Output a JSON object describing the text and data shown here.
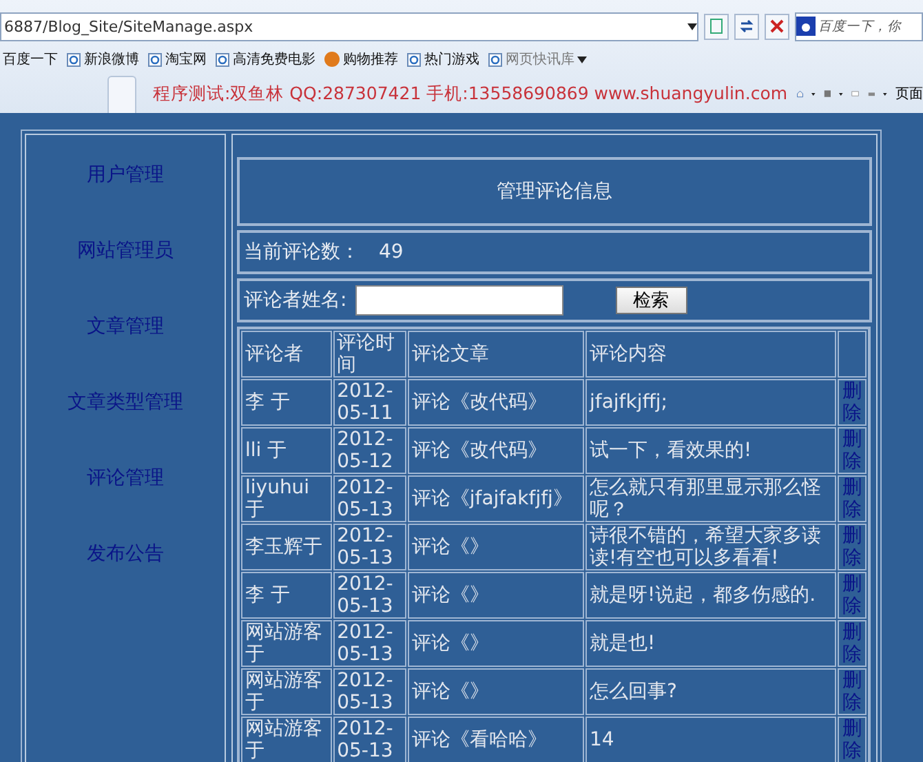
{
  "address_bar": {
    "url": "6887/Blog_Site/SiteManage.aspx",
    "search_placeholder": "百度一下，你"
  },
  "favorites": [
    {
      "label": "百度一下",
      "kind": "plain"
    },
    {
      "label": "新浪微博",
      "kind": "ie"
    },
    {
      "label": "淘宝网",
      "kind": "ie"
    },
    {
      "label": "高清免费电影",
      "kind": "ie"
    },
    {
      "label": "购物推荐",
      "kind": "shop"
    },
    {
      "label": "热门游戏",
      "kind": "ie"
    },
    {
      "label": "网页快讯库",
      "kind": "menu"
    }
  ],
  "command_bar": {
    "banner": "程序测试:双鱼林 QQ:287307421 手机:13558690869 www.shuangyulin.com",
    "page_menu": "页面"
  },
  "sidebar": {
    "items": [
      "用户管理",
      "网站管理员",
      "文章管理",
      "文章类型管理",
      "评论管理",
      "发布公告"
    ]
  },
  "main": {
    "title": "管理评论信息",
    "count_label": "当前评论数：",
    "count": "49",
    "search_label": "评论者姓名:",
    "search_button": "检索",
    "table": {
      "columns": [
        "评论者",
        "评论时间",
        "评论文章",
        "评论内容"
      ],
      "rows": [
        {
          "author": "李 于",
          "time": "2012-05-11",
          "article": "评论《改代码》",
          "content": "jfajfkjffj;",
          "action": "删除"
        },
        {
          "author": "lli 于",
          "time": "2012-05-12",
          "article": "评论《改代码》",
          "content": "试一下，看效果的!",
          "action": "删除"
        },
        {
          "author": "liyuhui 于",
          "time": "2012-05-13",
          "article": "评论《jfajfakfjfj》",
          "content": "怎么就只有那里显示那么怪呢？",
          "action": "删除"
        },
        {
          "author": "李玉辉于",
          "time": "2012-05-13",
          "article": "评论《》",
          "content": "诗很不错的，希望大家多读读!有空也可以多看看!",
          "action": "删除"
        },
        {
          "author": "李 于",
          "time": "2012-05-13",
          "article": "评论《》",
          "content": "就是呀!说起，都多伤感的.",
          "action": "删除"
        },
        {
          "author": "网站游客于",
          "time": "2012-05-13",
          "article": "评论《》",
          "content": "就是也!",
          "action": "删除"
        },
        {
          "author": "网站游客于",
          "time": "2012-05-13",
          "article": "评论《》",
          "content": "怎么回事?",
          "action": "删除"
        },
        {
          "author": "网站游客于",
          "time": "2012-05-13",
          "article": "评论《看哈哈》",
          "content": "14",
          "action": "删除"
        }
      ]
    }
  }
}
